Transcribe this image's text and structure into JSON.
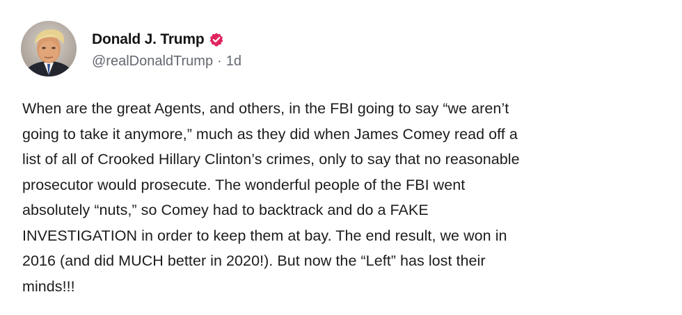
{
  "post": {
    "author": {
      "display_name": "Donald J. Trump",
      "handle": "@realDonaldTrump",
      "verified": true,
      "verified_color": "#e0245e",
      "avatar_icon": "user-avatar-photo"
    },
    "separator": "·",
    "timestamp": "1d",
    "text": "When are the great Agents, and others, in the FBI going to say “we aren’t\ngoing to take it anymore,” much as they did when James Comey read off a\nlist of all of Crooked Hillary Clinton’s crimes, only to say that no reasonable\nprosecutor would prosecute. The wonderful people of the FBI went\nabsolutely “nuts,” so Comey had to backtrack and do a FAKE\nINVESTIGATION in order to keep them at bay. The end result, we won in\n2016 (and did MUCH better in 2020!). But now the “Left” has lost their\nminds!!!"
  }
}
